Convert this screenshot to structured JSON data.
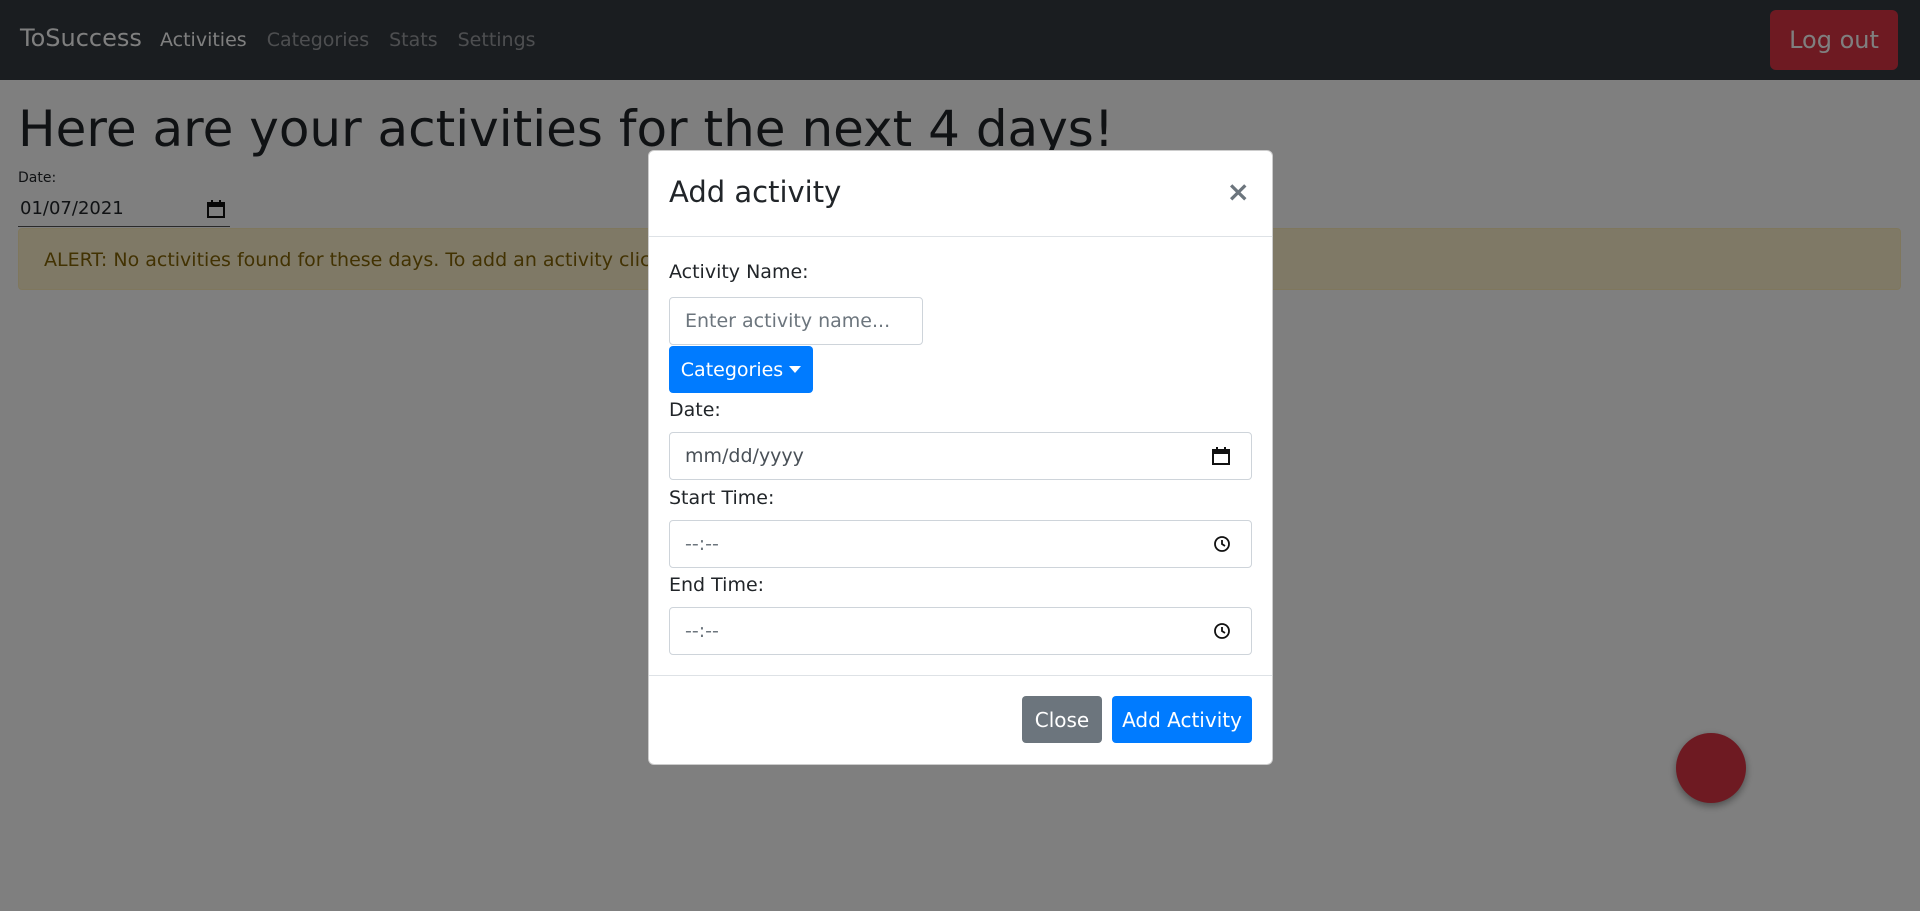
{
  "navbar": {
    "brand": "ToSuccess",
    "links": [
      "Activities",
      "Categories",
      "Stats",
      "Settings"
    ],
    "logout_label": "Log out"
  },
  "page": {
    "title": "Here are your activities for the next 4 days!",
    "date_label": "Date:",
    "date_value": "01/07/2021",
    "alert_text": "ALERT: No activities found for these days. To add an activity click the"
  },
  "modal": {
    "title": "Add activity",
    "close_symbol": "×",
    "activity_name_label": "Activity Name:",
    "activity_name_placeholder": "Enter activity name...",
    "categories_label": "Categories",
    "date_label": "Date:",
    "date_placeholder": "mm/dd/yyyy",
    "start_time_label": "Start Time:",
    "start_time_placeholder": "--:--",
    "end_time_label": "End Time:",
    "end_time_placeholder": "--:--",
    "close_button": "Close",
    "add_button": "Add Activity"
  },
  "icons": {
    "calendar": "calendar-icon",
    "clock": "clock-icon"
  },
  "colors": {
    "navbar": "#343a40",
    "danger": "#dc3545",
    "primary": "#007bff",
    "secondary": "#6c757d",
    "alert_bg": "#fff3cd"
  }
}
